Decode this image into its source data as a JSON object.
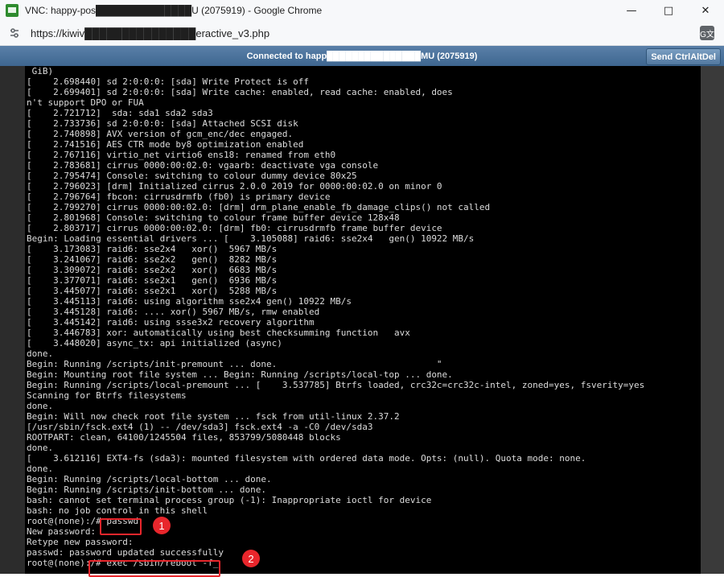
{
  "window": {
    "title": "VNC: happy-pos██████████████U (2075919) - Google Chrome",
    "app_icon": "vnc-icon",
    "controls": {
      "minimize": "—",
      "maximize": "□",
      "close": "✕"
    }
  },
  "address_bar": {
    "url": "https://kiwiv███████████████eractive_v3.php",
    "translate_label": "G文"
  },
  "vnc": {
    "status": "Connected to happ███████████████MU (2075919)",
    "send_button": "Send CtrlAltDel"
  },
  "console_lines": [
    " GiB)",
    "[    2.698440] sd 2:0:0:0: [sda] Write Protect is off",
    "[    2.699401] sd 2:0:0:0: [sda] Write cache: enabled, read cache: enabled, does",
    "n't support DPO or FUA",
    "[    2.721712]  sda: sda1 sda2 sda3",
    "[    2.733736] sd 2:0:0:0: [sda] Attached SCSI disk",
    "[    2.740898] AVX version of gcm_enc/dec engaged.",
    "[    2.741516] AES CTR mode by8 optimization enabled",
    "[    2.767116] virtio_net virtio6 ens18: renamed from eth0",
    "[    2.783681] cirrus 0000:00:02.0: vgaarb: deactivate vga console",
    "[    2.795474] Console: switching to colour dummy device 80x25",
    "[    2.796023] [drm] Initialized cirrus 2.0.0 2019 for 0000:00:02.0 on minor 0",
    "[    2.796764] fbcon: cirrusdrmfb (fb0) is primary device",
    "[    2.799270] cirrus 0000:00:02.0: [drm] drm_plane_enable_fb_damage_clips() not called",
    "[    2.801968] Console: switching to colour frame buffer device 128x48",
    "[    2.803717] cirrus 0000:00:02.0: [drm] fb0: cirrusdrmfb frame buffer device",
    "Begin: Loading essential drivers ... [    3.105088] raid6: sse2x4   gen() 10922 MB/s",
    "[    3.173083] raid6: sse2x4   xor()  5967 MB/s",
    "[    3.241067] raid6: sse2x2   gen()  8282 MB/s",
    "[    3.309072] raid6: sse2x2   xor()  6683 MB/s",
    "[    3.377071] raid6: sse2x1   gen()  6936 MB/s",
    "[    3.445077] raid6: sse2x1   xor()  5288 MB/s",
    "[    3.445113] raid6: using algorithm sse2x4 gen() 10922 MB/s",
    "[    3.445128] raid6: .... xor() 5967 MB/s, rmw enabled",
    "[    3.445142] raid6: using ssse3x2 recovery algorithm",
    "[    3.446783] xor: automatically using best checksumming function   avx",
    "[    3.448020] async_tx: api initialized (async)",
    "done.",
    "Begin: Running /scripts/init-premount ... done.                              \"",
    "Begin: Mounting root file system ... Begin: Running /scripts/local-top ... done.",
    "Begin: Running /scripts/local-premount ... [    3.537785] Btrfs loaded, crc32c=crc32c-intel, zoned=yes, fsverity=yes",
    "Scanning for Btrfs filesystems",
    "done.",
    "Begin: Will now check root file system ... fsck from util-linux 2.37.2",
    "[/usr/sbin/fsck.ext4 (1) -- /dev/sda3] fsck.ext4 -a -C0 /dev/sda3",
    "ROOTPART: clean, 64100/1245504 files, 853799/5080448 blocks",
    "done.",
    "[    3.612116] EXT4-fs (sda3): mounted filesystem with ordered data mode. Opts: (null). Quota mode: none.",
    "done.",
    "Begin: Running /scripts/local-bottom ... done.",
    "Begin: Running /scripts/init-bottom ... done.",
    "bash: cannot set terminal process group (-1): Inappropriate ioctl for device",
    "bash: no job control in this shell",
    "root@(none):/# passwd",
    "New password:",
    "Retype new password:",
    "passwd: password updated successfully",
    "root@(none):/# exec /sbin/reboot -f_"
  ],
  "annotations": {
    "callout_1": "1",
    "callout_2": "2"
  }
}
